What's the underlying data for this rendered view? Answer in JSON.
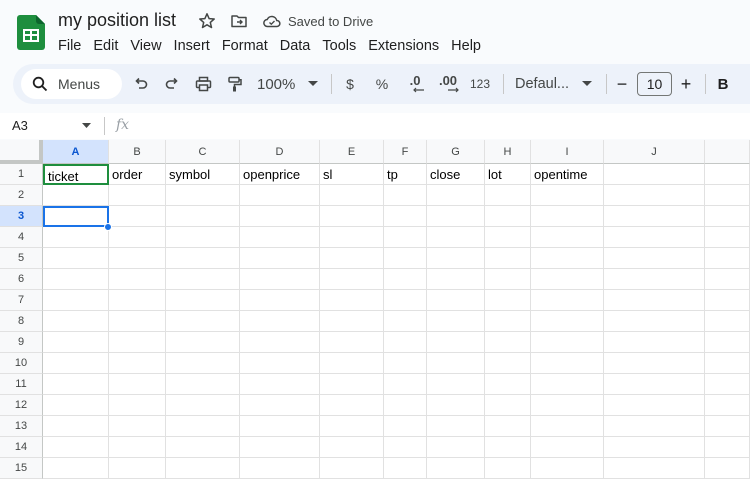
{
  "doc": {
    "title": "my position list",
    "saved_status": "Saved to Drive"
  },
  "menu": [
    "File",
    "Edit",
    "View",
    "Insert",
    "Format",
    "Data",
    "Tools",
    "Extensions",
    "Help"
  ],
  "toolbar": {
    "search_label": "Menus",
    "zoom": "100%",
    "currency": "$",
    "percent": "%",
    "decrease_decimal": ".0",
    "increase_decimal": ".00",
    "number_format": "123",
    "font": "Defaul...",
    "font_size_minus": "−",
    "font_size": "10",
    "font_size_plus": "+",
    "bold": "B"
  },
  "formula_bar": {
    "name_box": "A3",
    "fx": "fx",
    "content": ""
  },
  "columns": [
    "A",
    "B",
    "C",
    "D",
    "E",
    "F",
    "G",
    "H",
    "I",
    "J"
  ],
  "rows": [
    "1",
    "2",
    "3",
    "4",
    "5",
    "6",
    "7",
    "8",
    "9",
    "10",
    "11",
    "12",
    "13",
    "14",
    "15"
  ],
  "cells": {
    "row1": [
      "ticket",
      "order",
      "symbol",
      "openprice",
      "sl",
      "tp",
      "close",
      "lot",
      "opentime",
      ""
    ]
  },
  "selection": {
    "active_cell": "A3",
    "selected_column": "A",
    "selected_row": "3"
  },
  "colors": {
    "accent": "#1a73e8",
    "sheets_green": "#1e8e3e",
    "toolbar_bg": "#edf2fa"
  }
}
